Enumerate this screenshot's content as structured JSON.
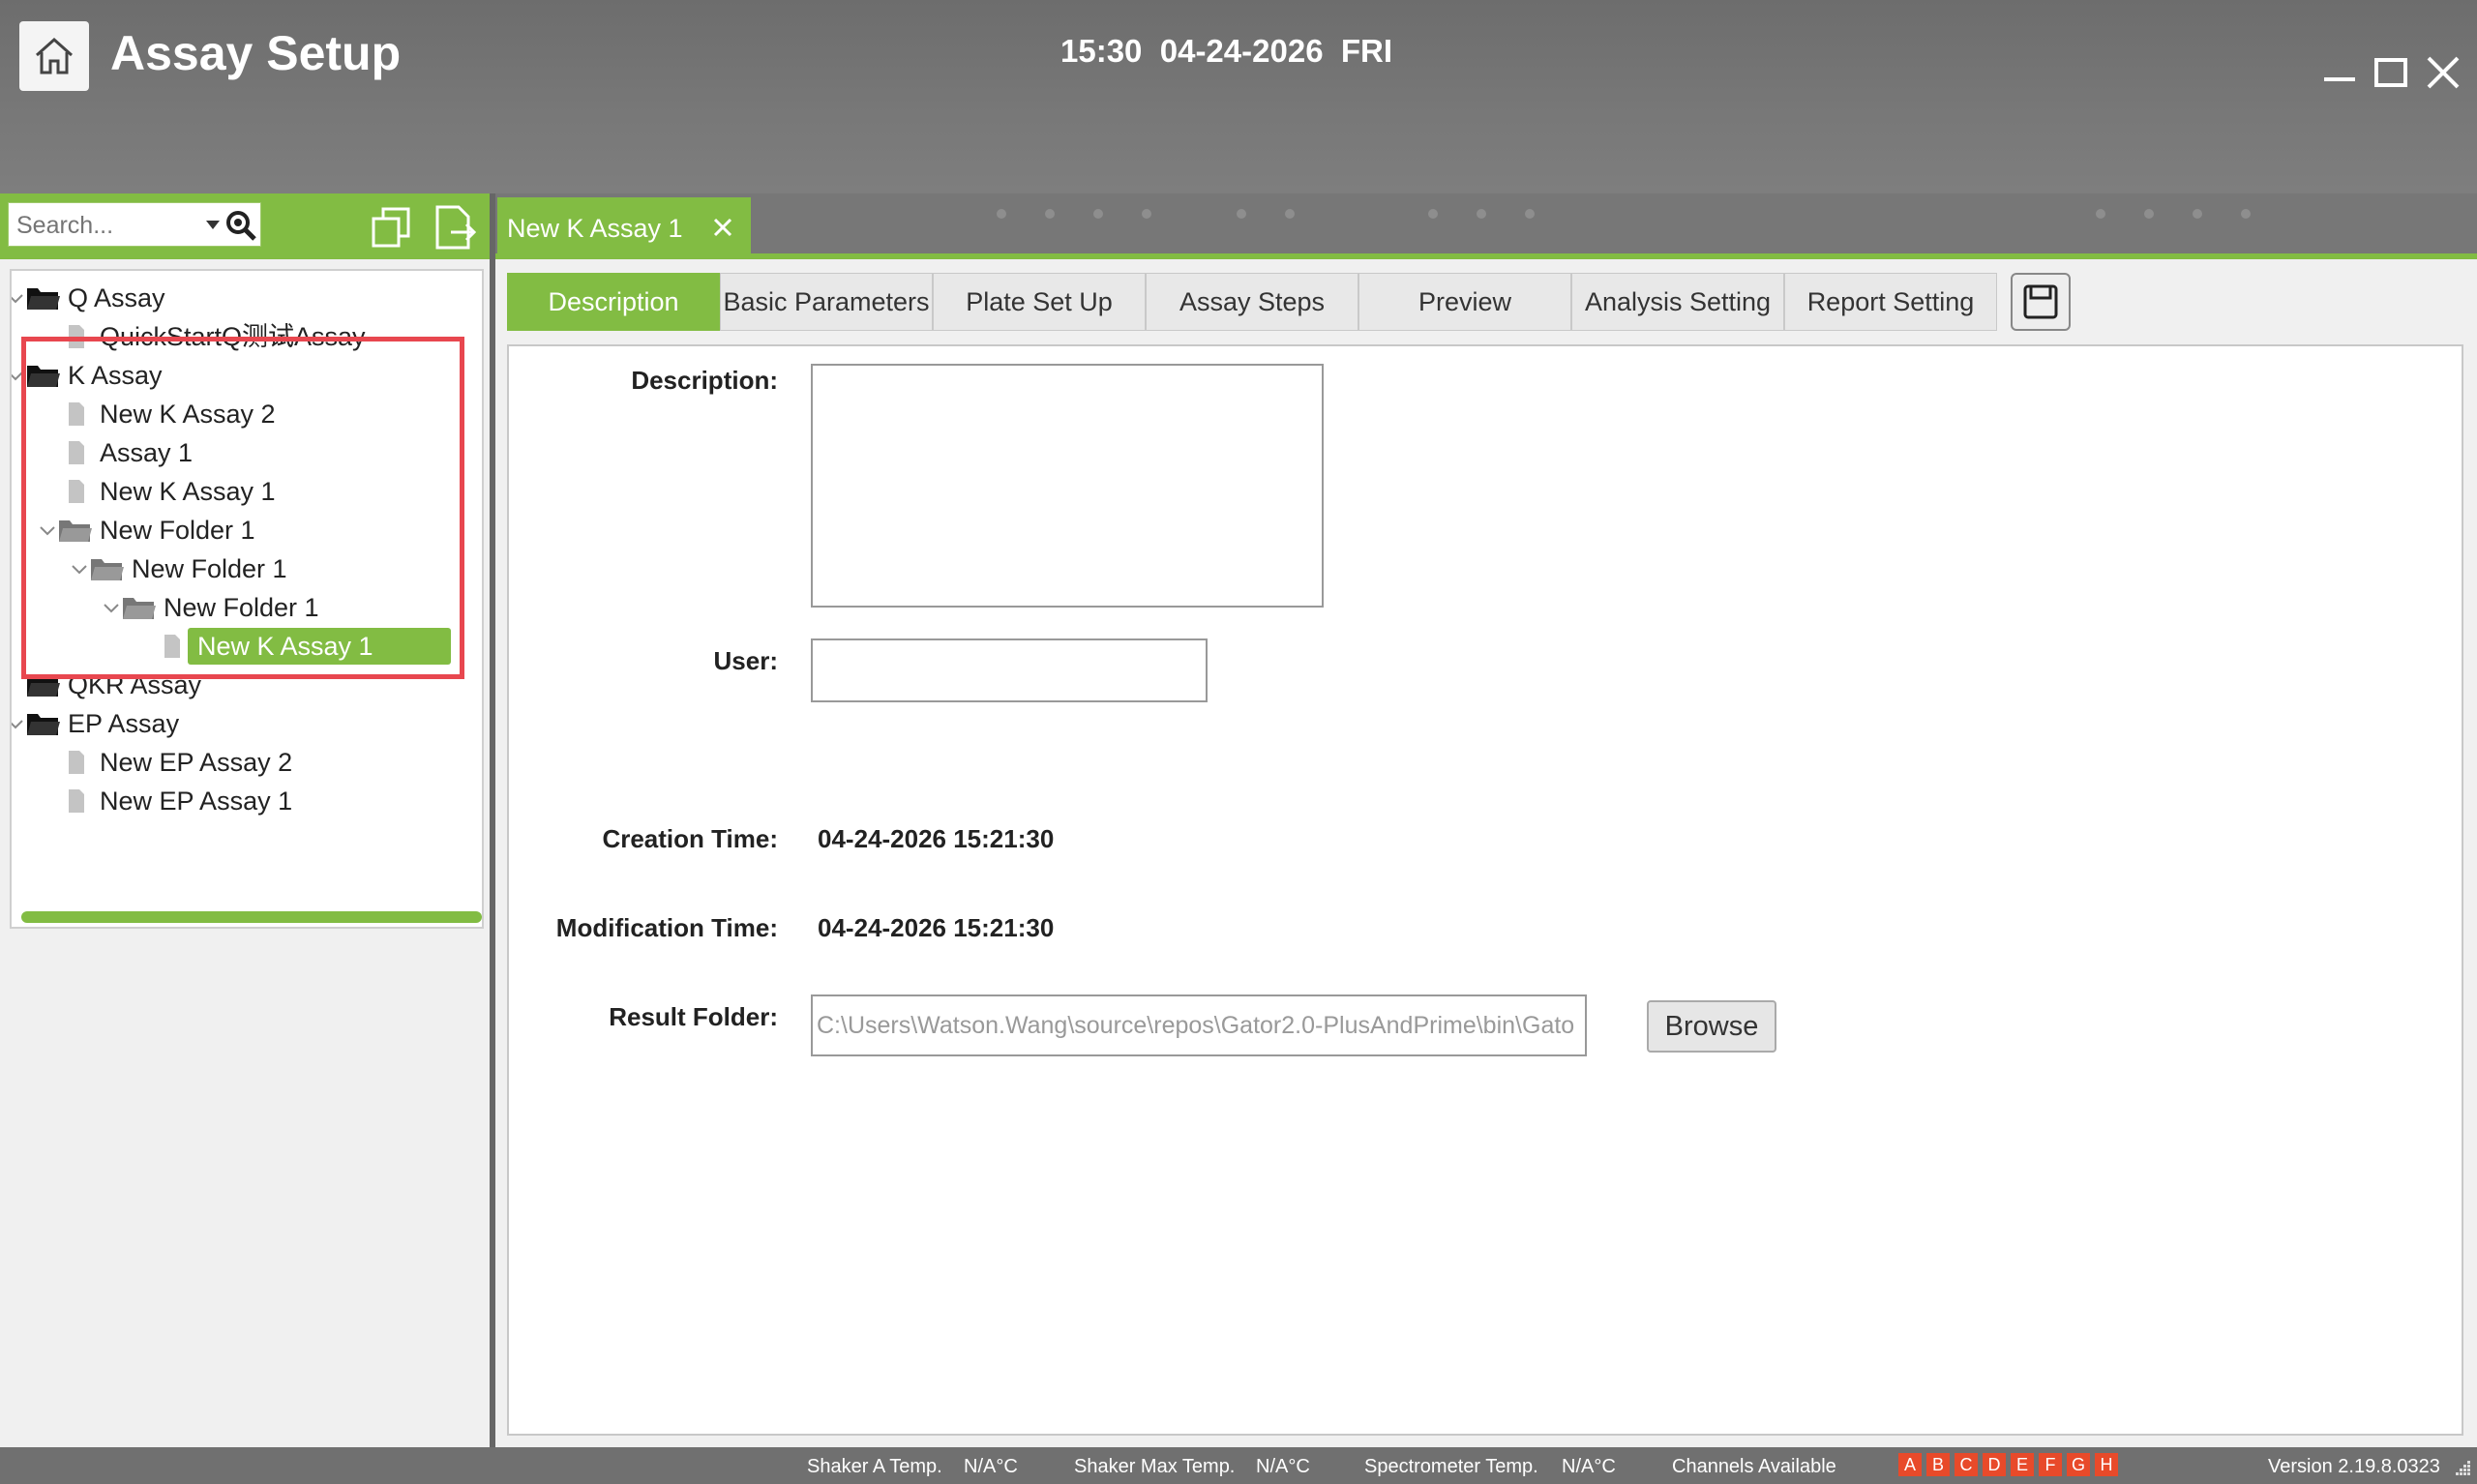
{
  "window": {
    "title": "Assay Setup",
    "clock": "15:30  04-24-2026  FRI"
  },
  "search": {
    "placeholder": "Search..."
  },
  "tree": [
    {
      "label": "Q Assay",
      "kind": "folder",
      "level": 0,
      "expanded": true
    },
    {
      "label": "QuickStartQ测试Assay",
      "kind": "file",
      "level": 1
    },
    {
      "label": "K Assay",
      "kind": "folder",
      "level": 0,
      "expanded": true
    },
    {
      "label": "New K Assay 2",
      "kind": "file",
      "level": 1
    },
    {
      "label": "Assay 1",
      "kind": "file",
      "level": 1
    },
    {
      "label": "New K Assay 1",
      "kind": "file",
      "level": 1
    },
    {
      "label": "New Folder 1",
      "kind": "folder",
      "level": 1,
      "expanded": true
    },
    {
      "label": "New Folder 1",
      "kind": "folder",
      "level": 2,
      "expanded": true
    },
    {
      "label": "New Folder 1",
      "kind": "folder",
      "level": 3,
      "expanded": true
    },
    {
      "label": "New K Assay 1",
      "kind": "file",
      "level": 4,
      "selected": true
    },
    {
      "label": "QKR Assay",
      "kind": "folder",
      "level": 0,
      "expanded": false
    },
    {
      "label": "EP Assay",
      "kind": "folder",
      "level": 0,
      "expanded": true
    },
    {
      "label": "New EP Assay 2",
      "kind": "file",
      "level": 1
    },
    {
      "label": "New EP Assay 1",
      "kind": "file",
      "level": 1
    }
  ],
  "doc_tab": {
    "label": "New K Assay 1"
  },
  "tabs": [
    {
      "label": "Description",
      "active": true
    },
    {
      "label": "Basic Parameters"
    },
    {
      "label": "Plate Set Up"
    },
    {
      "label": "Assay Steps"
    },
    {
      "label": "Preview"
    },
    {
      "label": "Analysis Setting"
    },
    {
      "label": "Report Setting"
    }
  ],
  "form": {
    "description_label": "Description:",
    "description_value": "",
    "user_label": "User:",
    "user_value": "",
    "creation_label": "Creation Time:",
    "creation_value": "04-24-2026 15:21:30",
    "modification_label": "Modification Time:",
    "modification_value": "04-24-2026 15:21:30",
    "result_folder_label": "Result Folder:",
    "result_folder_value": "C:\\Users\\Watson.Wang\\source\\repos\\Gator2.0-PlusAndPrime\\bin\\Gato",
    "browse_label": "Browse"
  },
  "status": {
    "shaker_a_label": "Shaker A Temp.",
    "shaker_a_value": "N/A°C",
    "shaker_max_label": "Shaker Max Temp.",
    "shaker_max_value": "N/A°C",
    "spectrometer_label": "Spectrometer Temp.",
    "spectrometer_value": "N/A°C",
    "channels_label": "Channels Available",
    "channels": [
      "A",
      "B",
      "C",
      "D",
      "E",
      "F",
      "G",
      "H"
    ],
    "version": "Version 2.19.8.0323"
  },
  "colors": {
    "accent": "#82bc43",
    "titlebar": "#737373",
    "highlight": "#e8474f",
    "channel": "#e84a2a"
  },
  "icons": [
    "home-icon",
    "search-icon",
    "copy-icon",
    "export-icon",
    "close-icon",
    "save-icon",
    "folder-icon",
    "file-icon",
    "chevron-down-icon",
    "minimize-icon",
    "maximize-icon"
  ]
}
